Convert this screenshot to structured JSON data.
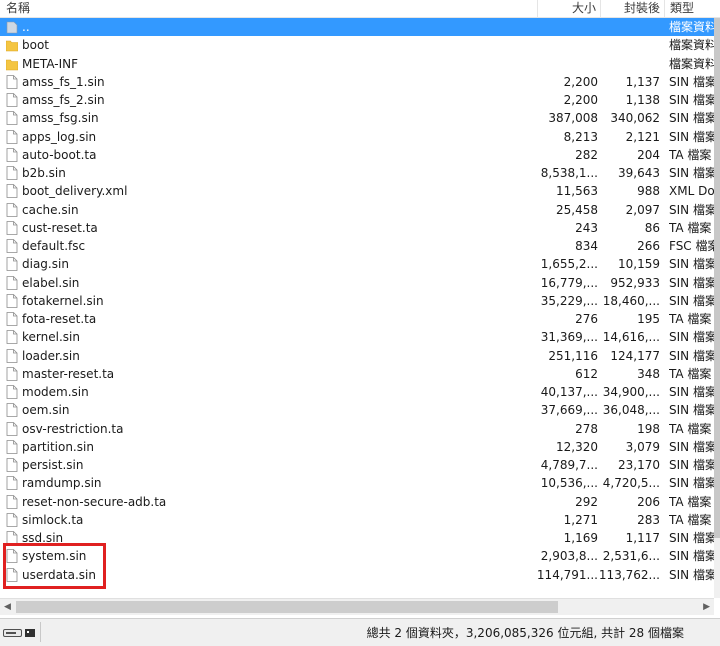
{
  "columns": {
    "name": "名稱",
    "size": "大小",
    "packed": "封裝後",
    "type": "類型"
  },
  "rows": [
    {
      "name": "..",
      "size": "",
      "packed": "",
      "type": "檔案資料夾",
      "icon": "parent-folder-icon",
      "selected": true
    },
    {
      "name": "boot",
      "size": "",
      "packed": "",
      "type": "檔案資料夾",
      "icon": "folder-icon"
    },
    {
      "name": "META-INF",
      "size": "",
      "packed": "",
      "type": "檔案資料夾",
      "icon": "folder-icon"
    },
    {
      "name": "amss_fs_1.sin",
      "size": "2,200",
      "packed": "1,137",
      "type": "SIN 檔案",
      "icon": "file-icon"
    },
    {
      "name": "amss_fs_2.sin",
      "size": "2,200",
      "packed": "1,138",
      "type": "SIN 檔案",
      "icon": "file-icon"
    },
    {
      "name": "amss_fsg.sin",
      "size": "387,008",
      "packed": "340,062",
      "type": "SIN 檔案",
      "icon": "file-icon"
    },
    {
      "name": "apps_log.sin",
      "size": "8,213",
      "packed": "2,121",
      "type": "SIN 檔案",
      "icon": "file-icon"
    },
    {
      "name": "auto-boot.ta",
      "size": "282",
      "packed": "204",
      "type": "TA 檔案",
      "icon": "file-icon"
    },
    {
      "name": "b2b.sin",
      "size": "8,538,1...",
      "packed": "39,643",
      "type": "SIN 檔案",
      "icon": "file-icon"
    },
    {
      "name": "boot_delivery.xml",
      "size": "11,563",
      "packed": "988",
      "type": "XML Do",
      "icon": "file-icon"
    },
    {
      "name": "cache.sin",
      "size": "25,458",
      "packed": "2,097",
      "type": "SIN 檔案",
      "icon": "file-icon"
    },
    {
      "name": "cust-reset.ta",
      "size": "243",
      "packed": "86",
      "type": "TA 檔案",
      "icon": "file-icon"
    },
    {
      "name": "default.fsc",
      "size": "834",
      "packed": "266",
      "type": "FSC 檔案",
      "icon": "file-icon"
    },
    {
      "name": "diag.sin",
      "size": "1,655,2...",
      "packed": "10,159",
      "type": "SIN 檔案",
      "icon": "file-icon"
    },
    {
      "name": "elabel.sin",
      "size": "16,779,...",
      "packed": "952,933",
      "type": "SIN 檔案",
      "icon": "file-icon"
    },
    {
      "name": "fotakernel.sin",
      "size": "35,229,...",
      "packed": "18,460,...",
      "type": "SIN 檔案",
      "icon": "file-icon"
    },
    {
      "name": "fota-reset.ta",
      "size": "276",
      "packed": "195",
      "type": "TA 檔案",
      "icon": "file-icon"
    },
    {
      "name": "kernel.sin",
      "size": "31,369,...",
      "packed": "14,616,...",
      "type": "SIN 檔案",
      "icon": "file-icon"
    },
    {
      "name": "loader.sin",
      "size": "251,116",
      "packed": "124,177",
      "type": "SIN 檔案",
      "icon": "file-icon"
    },
    {
      "name": "master-reset.ta",
      "size": "612",
      "packed": "348",
      "type": "TA 檔案",
      "icon": "file-icon"
    },
    {
      "name": "modem.sin",
      "size": "40,137,...",
      "packed": "34,900,...",
      "type": "SIN 檔案",
      "icon": "file-icon"
    },
    {
      "name": "oem.sin",
      "size": "37,669,...",
      "packed": "36,048,...",
      "type": "SIN 檔案",
      "icon": "file-icon"
    },
    {
      "name": "osv-restriction.ta",
      "size": "278",
      "packed": "198",
      "type": "TA 檔案",
      "icon": "file-icon"
    },
    {
      "name": "partition.sin",
      "size": "12,320",
      "packed": "3,079",
      "type": "SIN 檔案",
      "icon": "file-icon"
    },
    {
      "name": "persist.sin",
      "size": "4,789,7...",
      "packed": "23,170",
      "type": "SIN 檔案",
      "icon": "file-icon"
    },
    {
      "name": "ramdump.sin",
      "size": "10,536,...",
      "packed": "4,720,5...",
      "type": "SIN 檔案",
      "icon": "file-icon"
    },
    {
      "name": "reset-non-secure-adb.ta",
      "size": "292",
      "packed": "206",
      "type": "TA 檔案",
      "icon": "file-icon"
    },
    {
      "name": "simlock.ta",
      "size": "1,271",
      "packed": "283",
      "type": "TA 檔案",
      "icon": "file-icon"
    },
    {
      "name": "ssd.sin",
      "size": "1,169",
      "packed": "1,117",
      "type": "SIN 檔案",
      "icon": "file-icon"
    },
    {
      "name": "system.sin",
      "size": "2,903,8...",
      "packed": "2,531,6...",
      "type": "SIN 檔案",
      "icon": "file-icon"
    },
    {
      "name": "userdata.sin",
      "size": "114,791...",
      "packed": "113,762...",
      "type": "SIN 檔案",
      "icon": "file-icon"
    }
  ],
  "status": {
    "summary": "總共 2 個資料夾，3,206,085,326 位元組, 共計 28 個檔案"
  },
  "colors": {
    "selection": "#3399ff",
    "folder": "#f4c542",
    "highlight_box": "#e02020"
  }
}
